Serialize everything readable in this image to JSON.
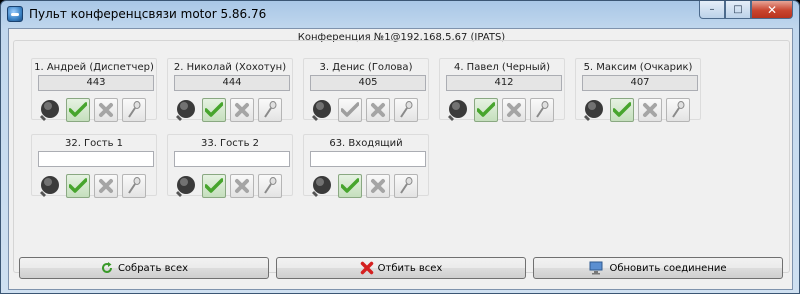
{
  "window": {
    "title": "Пульт конференцсвязи motor   5.86.76",
    "caption_minimize": "–",
    "caption_maximize": "□",
    "caption_close": "✕"
  },
  "conference": {
    "title": "Конференция №1@192.168.5.67 (IPATS)"
  },
  "participants": [
    {
      "name": "1. Андрей (Диспетчер)",
      "number": "443",
      "accepted": true
    },
    {
      "name": "2. Николай (Хохотун)",
      "number": "444",
      "accepted": true
    },
    {
      "name": "3. Денис (Голова)",
      "number": "405",
      "accepted": false
    },
    {
      "name": "4. Павел (Черный)",
      "number": "412",
      "accepted": true
    },
    {
      "name": "5. Максим (Очкарик)",
      "number": "407",
      "accepted": true
    },
    {
      "name": "32. Гость 1",
      "number": "",
      "accepted": true
    },
    {
      "name": "33. Гость 2",
      "number": "",
      "accepted": true
    },
    {
      "name": "63. Входящий",
      "number": "",
      "accepted": true
    }
  ],
  "buttons": {
    "gather_all": "Собрать всех",
    "drop_all": "Отбить всех",
    "refresh_connection": "Обновить соединение"
  },
  "icons": {
    "phone": "phone-icon",
    "accept": "check-icon",
    "reject": "cross-icon",
    "microphone": "microphone-icon",
    "gather": "refresh-icon",
    "drop": "red-x-icon",
    "refresh": "computer-icon"
  },
  "colors": {
    "accent_green": "#47a52d",
    "reject_gray": "#9e9e9e",
    "drop_red": "#d42020"
  }
}
